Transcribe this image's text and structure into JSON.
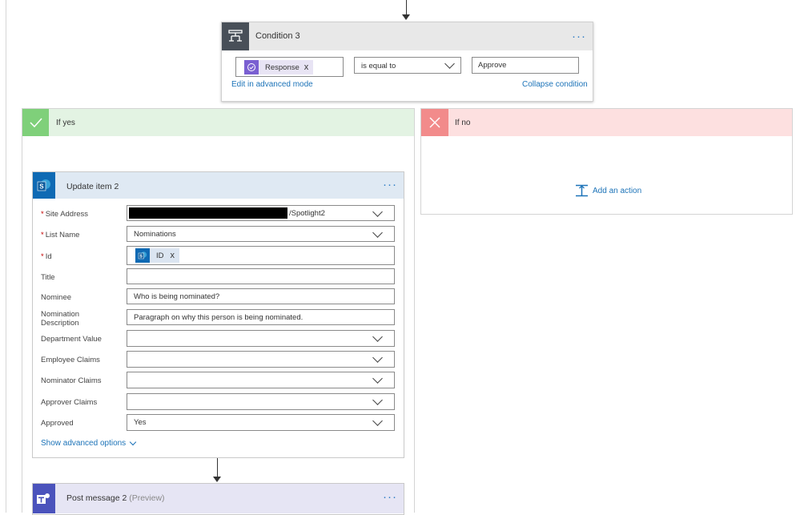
{
  "condition": {
    "title": "Condition 3",
    "menu": "···",
    "token_label": "Response",
    "token_remove": "x",
    "operator": "is equal to",
    "value": "Approve",
    "advanced_link": "Edit in advanced mode",
    "collapse_link": "Collapse condition"
  },
  "branch_yes": {
    "label": "If yes"
  },
  "branch_no": {
    "label": "If no",
    "add_action": "Add an action"
  },
  "update_item": {
    "title": "Update item 2",
    "menu": "···",
    "required_mark": "*",
    "fields": {
      "site_address": {
        "label": "Site Address",
        "value": "/Spotlight2"
      },
      "list_name": {
        "label": "List Name",
        "value": "Nominations"
      },
      "id": {
        "label": "Id",
        "token": "ID",
        "token_remove": "x"
      },
      "title": {
        "label": "Title",
        "value": ""
      },
      "nominee": {
        "label": "Nominee",
        "value": "Who is being nominated?"
      },
      "nomination_description": {
        "label_line1": "Nomination",
        "label_line2": "Description",
        "value": "Paragraph on why this person is being nominated."
      },
      "department_value": {
        "label": "Department Value",
        "value": ""
      },
      "employee_claims": {
        "label": "Employee Claims",
        "value": ""
      },
      "nominator_claims": {
        "label": "Nominator Claims",
        "value": ""
      },
      "approver_claims": {
        "label": "Approver Claims",
        "value": ""
      },
      "approved": {
        "label": "Approved",
        "value": "Yes"
      }
    },
    "advanced_options": "Show advanced options"
  },
  "post_message": {
    "title": "Post message 2",
    "preview": "(Preview)",
    "menu": "···"
  },
  "colors": {
    "accent_link": "#1c73b8",
    "yes_green": "#7fd07a",
    "no_red": "#f28b8b",
    "sharepoint_blue": "#0f6ab4",
    "teams_purple": "#4b53bc"
  }
}
